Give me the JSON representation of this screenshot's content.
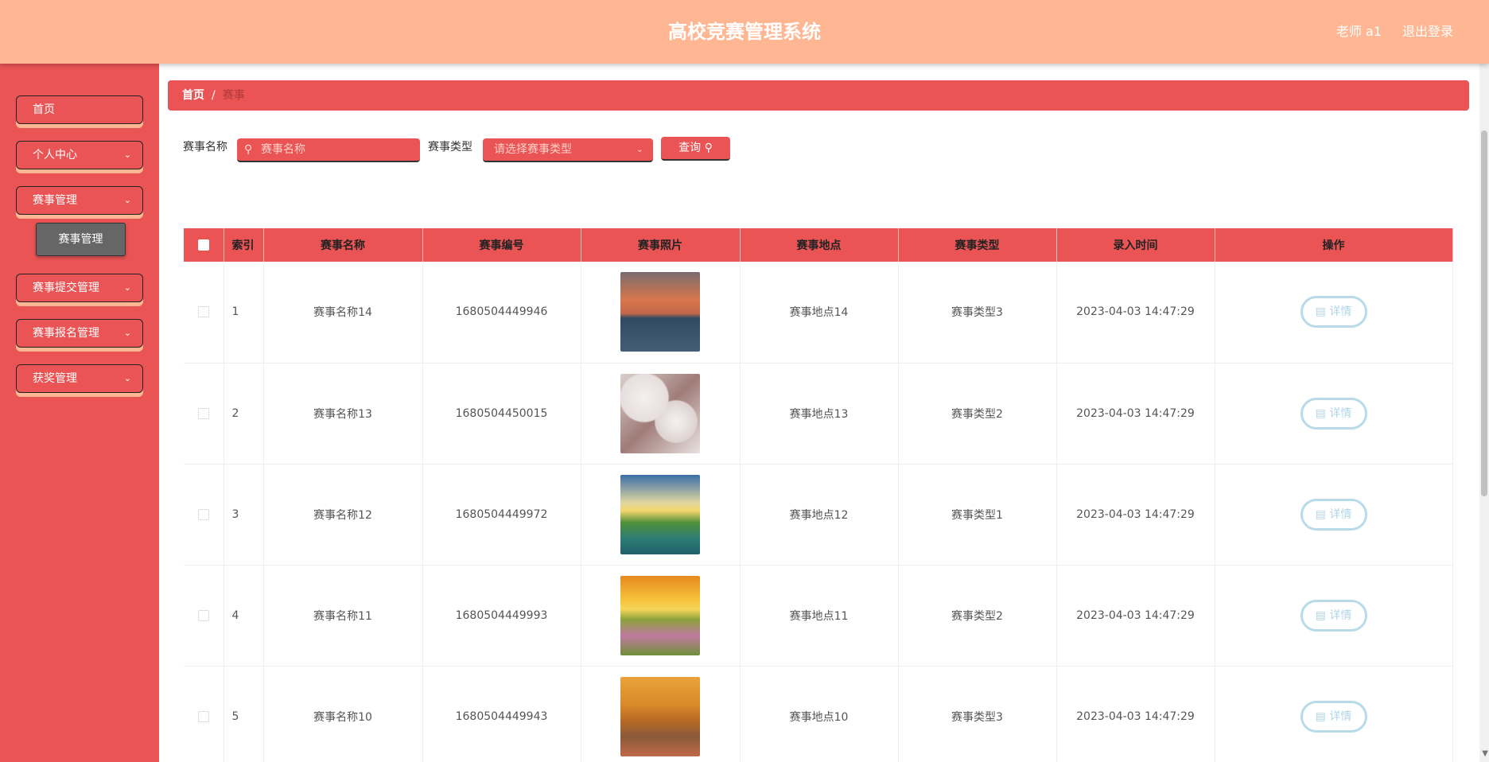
{
  "header": {
    "title": "高校竞赛管理系统",
    "user": "老师 a1",
    "logout": "退出登录"
  },
  "sidebar": {
    "items": [
      {
        "label": "首页",
        "has_children": false
      },
      {
        "label": "个人中心",
        "has_children": true
      },
      {
        "label": "赛事管理",
        "has_children": true
      },
      {
        "label": "赛事提交管理",
        "has_children": true
      },
      {
        "label": "赛事报名管理",
        "has_children": true
      },
      {
        "label": "获奖管理",
        "has_children": true
      }
    ],
    "submenu": {
      "label": "赛事管理"
    }
  },
  "breadcrumb": {
    "home": "首页",
    "separator": "/",
    "current": "赛事"
  },
  "search": {
    "name_label": "赛事名称",
    "name_placeholder": "赛事名称",
    "type_label": "赛事类型",
    "type_placeholder": "请选择赛事类型",
    "query_button": "查询"
  },
  "table": {
    "headers": [
      "索引",
      "赛事名称",
      "赛事编号",
      "赛事照片",
      "赛事地点",
      "赛事类型",
      "录入时间",
      "操作"
    ],
    "detail_label": "详情",
    "rows": [
      {
        "index": "1",
        "name": "赛事名称14",
        "code": "1680504449946",
        "location": "赛事地点14",
        "type": "赛事类型3",
        "time": "2023-04-03 14:47:29"
      },
      {
        "index": "2",
        "name": "赛事名称13",
        "code": "1680504450015",
        "location": "赛事地点13",
        "type": "赛事类型2",
        "time": "2023-04-03 14:47:29"
      },
      {
        "index": "3",
        "name": "赛事名称12",
        "code": "1680504449972",
        "location": "赛事地点12",
        "type": "赛事类型1",
        "time": "2023-04-03 14:47:29"
      },
      {
        "index": "4",
        "name": "赛事名称11",
        "code": "1680504449993",
        "location": "赛事地点11",
        "type": "赛事类型2",
        "time": "2023-04-03 14:47:29"
      },
      {
        "index": "5",
        "name": "赛事名称10",
        "code": "1680504449943",
        "location": "赛事地点10",
        "type": "赛事类型3",
        "time": "2023-04-03 14:47:29"
      }
    ]
  },
  "colors": {
    "primary": "#ea5455",
    "header": "#ffb692",
    "submenu": "#666666",
    "detail_border": "#b7dbe8"
  }
}
